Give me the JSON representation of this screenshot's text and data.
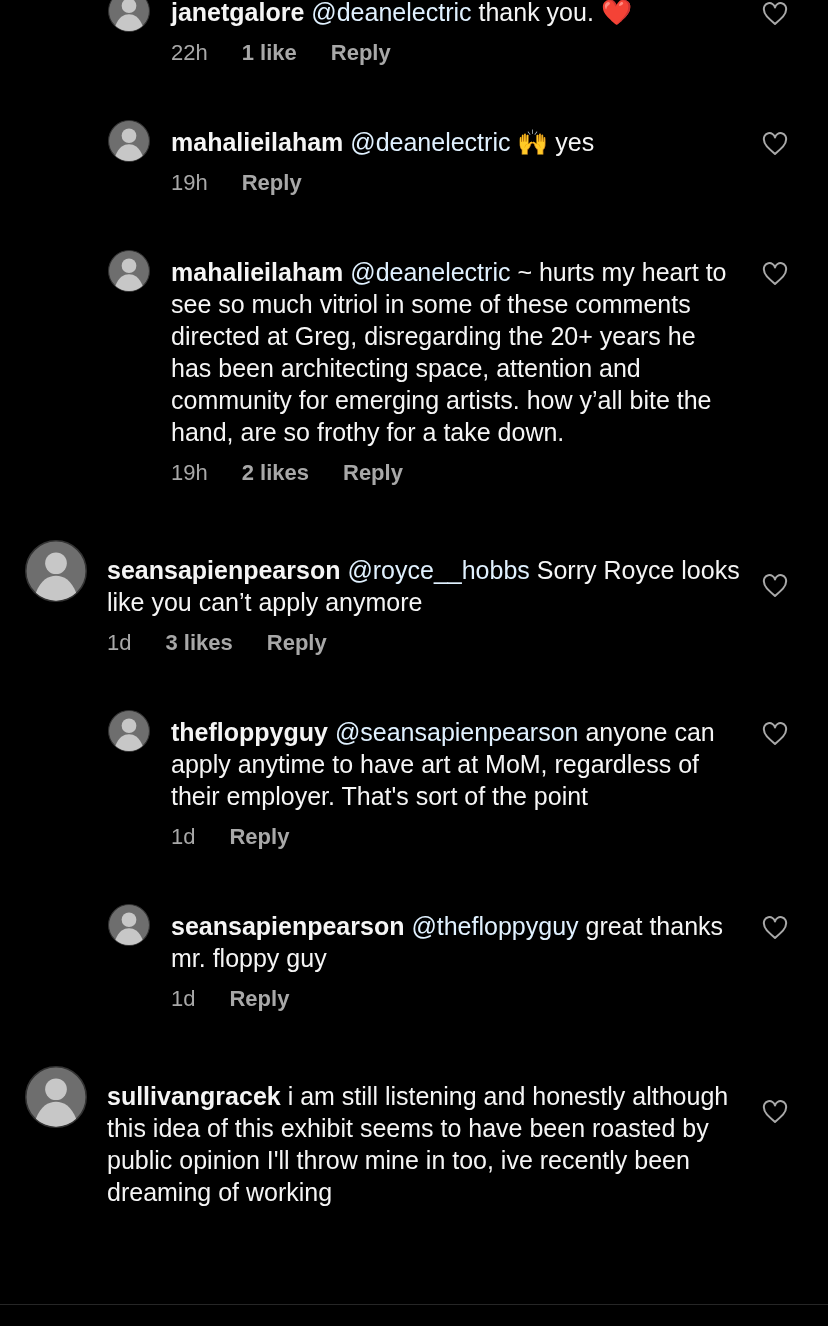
{
  "replies_to_hidden_comment": [
    {
      "user": "janetgalore",
      "mention": "@deanelectric",
      "text": "thank you. ❤️",
      "time": "22h",
      "likes": "1 like",
      "reply": "Reply"
    },
    {
      "user": "mahalieilaham",
      "mention": "@deanelectric",
      "text": "🙌 yes",
      "time": "19h",
      "reply": "Reply"
    },
    {
      "user": "mahalieilaham",
      "mention": "@deanelectric",
      "text": "~ hurts my heart to see so much vitriol in some of these comments directed at Greg, disregarding the 20+ years he has been architecting space, attention and community  for emerging artists. how y’all bite the hand, are so frothy for a take down.",
      "time": "19h",
      "likes": "2 likes",
      "reply": "Reply"
    }
  ],
  "comments": [
    {
      "user": "seansapienpearson",
      "mention": "@royce__hobbs",
      "text": "Sorry Royce looks like you can’t apply anymore",
      "time": "1d",
      "likes": "3 likes",
      "reply": "Reply",
      "children": [
        {
          "user": "thefloppyguy",
          "mention": "@seansapienpearson",
          "text": "anyone can apply anytime to have art at MoM, regardless of their employer. That's sort of the point",
          "time": "1d",
          "reply": "Reply"
        },
        {
          "user": "seansapienpearson",
          "mention": "@thefloppyguy",
          "text": "great thanks mr. floppy guy",
          "time": "1d",
          "reply": "Reply"
        }
      ]
    },
    {
      "user": "sullivangracek",
      "text": "i am still listening and honestly although this idea of this exhibit seems to have been roasted by public opinion I'll throw mine in too, ive recently been dreaming of working"
    }
  ]
}
